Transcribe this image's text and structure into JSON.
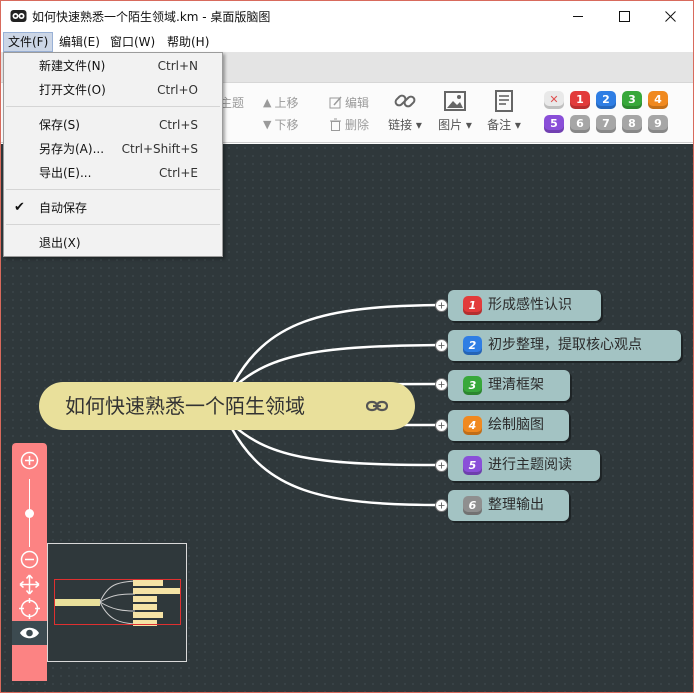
{
  "window": {
    "title": "如何快速熟悉一个陌生领域.km - 桌面版脑图"
  },
  "menubar": {
    "items": [
      {
        "label": "文件(F)"
      },
      {
        "label": "编辑(E)"
      },
      {
        "label": "窗口(W)"
      },
      {
        "label": "帮助(H)"
      }
    ]
  },
  "file_menu": {
    "items": [
      {
        "label": "新建文件(N)",
        "shortcut": "Ctrl+N"
      },
      {
        "label": "打开文件(O)",
        "shortcut": "Ctrl+O"
      },
      {
        "label": "保存(S)",
        "shortcut": "Ctrl+S"
      },
      {
        "label": "另存为(A)...",
        "shortcut": "Ctrl+Shift+S"
      },
      {
        "label": "导出(E)...",
        "shortcut": "Ctrl+E"
      },
      {
        "label": "自动保存",
        "shortcut": "",
        "checked": true
      },
      {
        "label": "退出(X)",
        "shortcut": ""
      }
    ]
  },
  "toolbar": {
    "topic_partial": "主题",
    "move_up": "上移",
    "move_down": "下移",
    "edit": "编辑",
    "delete": "删除",
    "link": "链接",
    "image": "图片",
    "note": "备注",
    "priorities_row1": [
      "1",
      "2",
      "3",
      "4"
    ],
    "priorities_row2": [
      "5",
      "6",
      "7",
      "8",
      "9"
    ]
  },
  "colors": {
    "canvas_bg": "#2f383b",
    "root_topic": "#e9e09b",
    "branch_topic": "#a3c3c3",
    "zoom_panel": "#fc8383",
    "priority_1": "#e23b3b",
    "priority_2": "#2f7ee4",
    "priority_3": "#38a83a",
    "priority_4": "#f0891f",
    "priority_5": "#8a4fd8",
    "priority_6": "#8f8f8f"
  },
  "mindmap": {
    "root": "如何快速熟悉一个陌生领域",
    "branches": [
      {
        "priority": "1",
        "text": "形成感性认识"
      },
      {
        "priority": "2",
        "text": "初步整理，提取核心观点"
      },
      {
        "priority": "3",
        "text": "理清框架"
      },
      {
        "priority": "4",
        "text": "绘制脑图"
      },
      {
        "priority": "5",
        "text": "进行主题阅读"
      },
      {
        "priority": "6",
        "text": "整理输出"
      }
    ]
  }
}
